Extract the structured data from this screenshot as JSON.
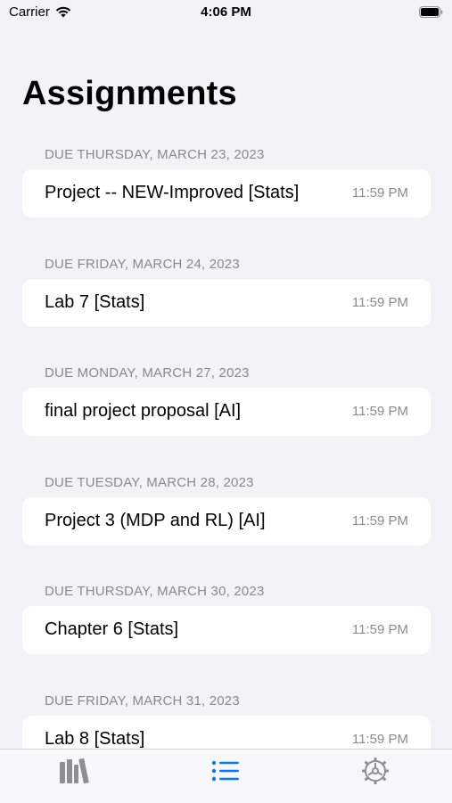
{
  "status_bar": {
    "carrier": "Carrier",
    "time": "4:06 PM"
  },
  "header": {
    "title": "Assignments"
  },
  "sections": [
    {
      "header": "DUE THURSDAY, MARCH 23, 2023",
      "title": "Project -- NEW-Improved [Stats]",
      "time": "11:59 PM"
    },
    {
      "header": "DUE FRIDAY, MARCH 24, 2023",
      "title": "Lab 7 [Stats]",
      "time": "11:59 PM"
    },
    {
      "header": "DUE MONDAY, MARCH 27, 2023",
      "title": "final project proposal [AI]",
      "time": "11:59 PM"
    },
    {
      "header": "DUE TUESDAY, MARCH 28, 2023",
      "title": "Project 3 (MDP and RL) [AI]",
      "time": "11:59 PM"
    },
    {
      "header": "DUE THURSDAY, MARCH 30, 2023",
      "title": "Chapter 6 [Stats]",
      "time": "11:59 PM"
    },
    {
      "header": "DUE FRIDAY, MARCH 31, 2023",
      "title": "Lab 8 [Stats]",
      "time": "11:59 PM"
    }
  ],
  "tab_bar": {
    "tabs": [
      {
        "icon": "books-icon",
        "selected": false
      },
      {
        "icon": "list-icon",
        "selected": true
      },
      {
        "icon": "gear-icon",
        "selected": false
      }
    ]
  },
  "colors": {
    "background": "#f2f2f7",
    "card": "#ffffff",
    "secondary_text": "#8a8a8e",
    "accent": "#007aff",
    "tab_inactive": "#8e8e93"
  }
}
